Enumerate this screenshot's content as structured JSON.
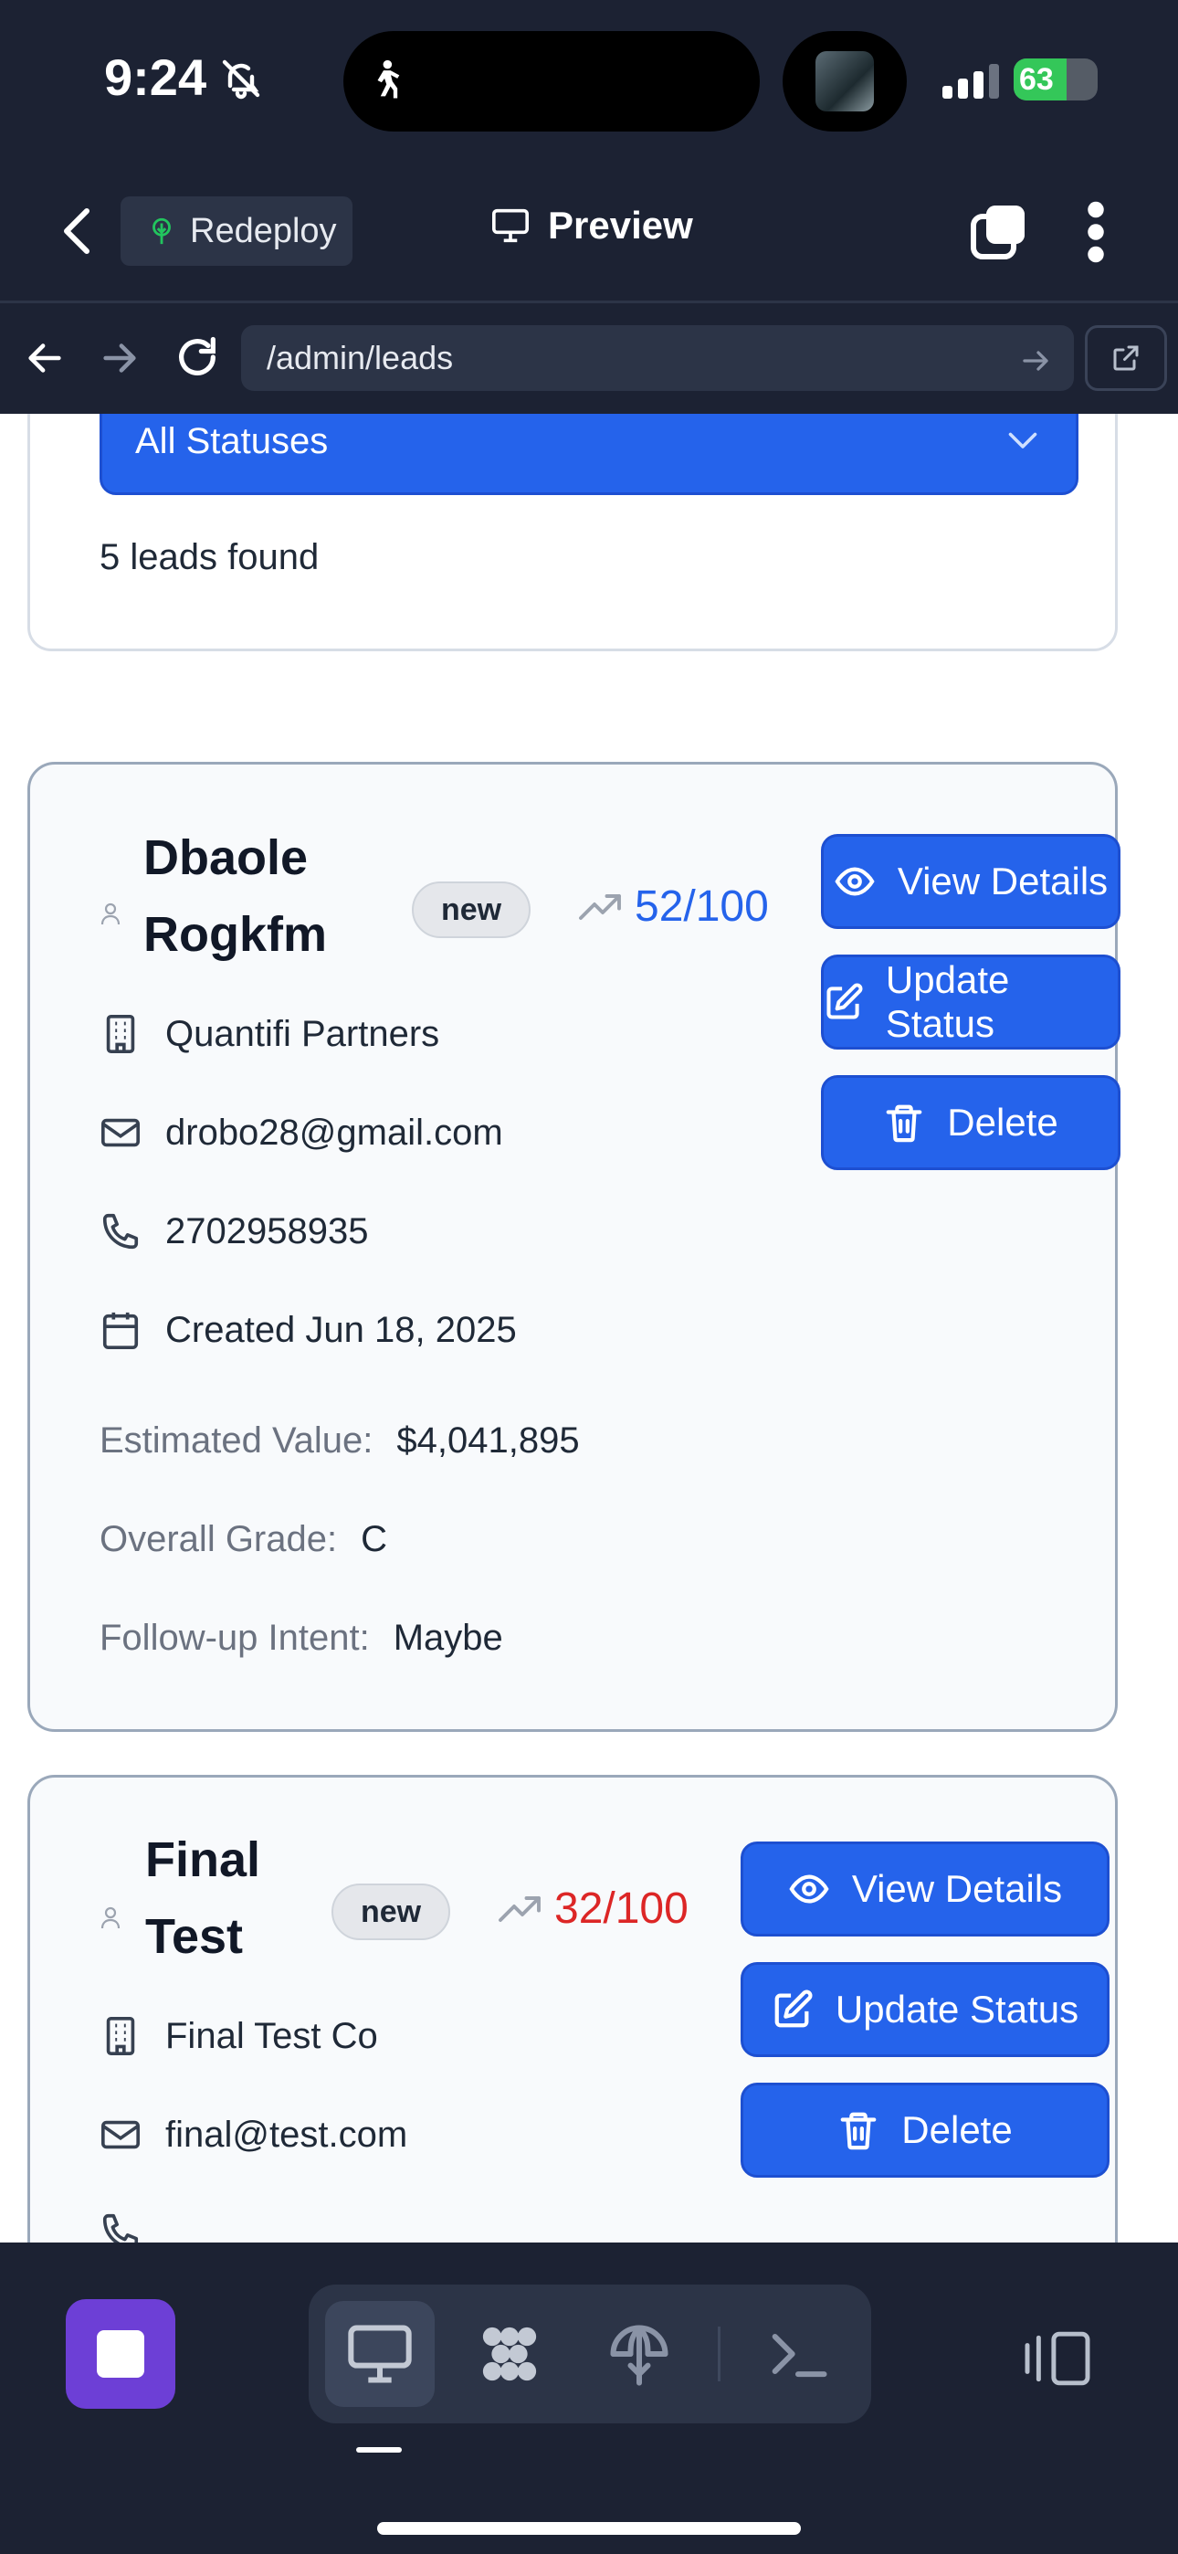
{
  "status_bar": {
    "time": "9:24",
    "battery": "63",
    "battery_level": 0.63
  },
  "header": {
    "redeploy_label": "Redeploy",
    "title": "Preview"
  },
  "browser": {
    "url": "/admin/leads"
  },
  "filter": {
    "status_value": "All Statuses",
    "count_text": "5 leads found"
  },
  "leads": [
    {
      "name_line1": "Dbaole",
      "name_line2": "Rogkfm",
      "badge": "new",
      "score": "52/100",
      "score_color": "#2563eb",
      "company": "Quantifi Partners",
      "email": "drobo28@gmail.com",
      "phone": "2702958935",
      "created": "Created Jun 18, 2025",
      "estimated_label": "Estimated Value:",
      "estimated_value": "$4,041,895",
      "grade_label": "Overall Grade:",
      "grade_value": "C",
      "intent_label": "Follow-up Intent:",
      "intent_value": "Maybe"
    },
    {
      "name_line1": "Final",
      "name_line2": "Test",
      "badge": "new",
      "score": "32/100",
      "score_color": "#dc2626",
      "company": "Final Test Co",
      "email": "final@test.com"
    }
  ],
  "actions": {
    "view_details": "View Details",
    "update_status": "Update Status",
    "delete": "Delete"
  },
  "colors": {
    "accent": "#2563eb",
    "chrome": "#1c2233",
    "stop": "#6d3fd6"
  }
}
